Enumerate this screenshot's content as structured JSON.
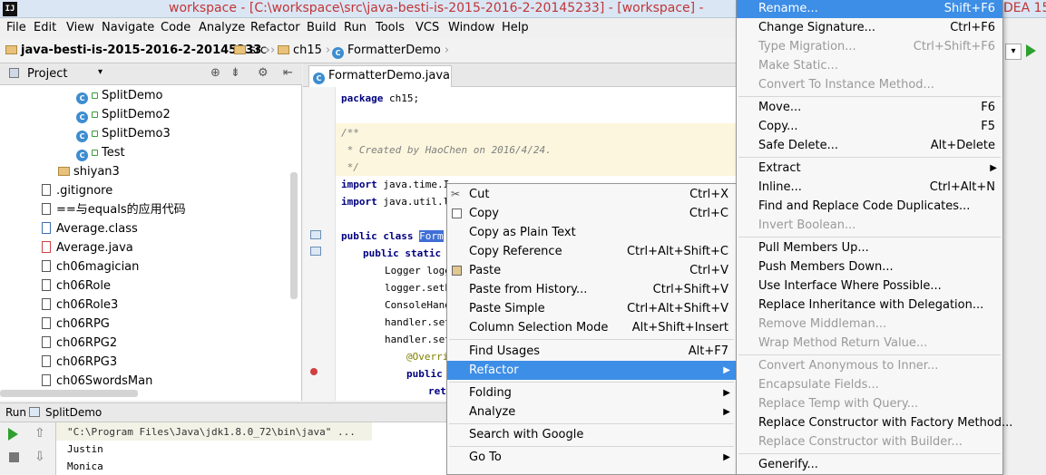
{
  "window": {
    "title": "workspace - [C:\\workspace\\src\\java-besti-is-2015-2016-2-20145233] - [workspace] -",
    "title_right": "DEA 15",
    "logo": "IJ"
  },
  "menubar": {
    "items": [
      "File",
      "Edit",
      "View",
      "Navigate",
      "Code",
      "Analyze",
      "Refactor",
      "Build",
      "Run",
      "Tools",
      "VCS",
      "Window",
      "Help"
    ]
  },
  "breadcrumb": {
    "items": [
      "java-besti-is-2015-2016-2-20145233",
      "src",
      "ch15",
      "FormatterDemo"
    ]
  },
  "project_panel": {
    "title": "Project",
    "tree": [
      {
        "label": "SplitDemo",
        "kind": "class"
      },
      {
        "label": "SplitDemo2",
        "kind": "class"
      },
      {
        "label": "SplitDemo3",
        "kind": "class"
      },
      {
        "label": "Test",
        "kind": "class"
      },
      {
        "label": "shiyan3",
        "kind": "folder"
      },
      {
        "label": ".gitignore",
        "kind": "file"
      },
      {
        "label": "==与equals的应用代码",
        "kind": "file"
      },
      {
        "label": "Average.class",
        "kind": "file"
      },
      {
        "label": "Average.java",
        "kind": "file"
      },
      {
        "label": "ch06magician",
        "kind": "file"
      },
      {
        "label": "ch06Role",
        "kind": "file"
      },
      {
        "label": "ch06Role3",
        "kind": "file"
      },
      {
        "label": "ch06RPG",
        "kind": "file"
      },
      {
        "label": "ch06RPG2",
        "kind": "file"
      },
      {
        "label": "ch06RPG3",
        "kind": "file"
      },
      {
        "label": "ch06SwordsMan",
        "kind": "file"
      }
    ]
  },
  "editor": {
    "tab_label": "FormatterDemo.java",
    "lines": {
      "l1_kw": "package",
      "l1_rest": " ch15;",
      "c1": "/**",
      "c2": " * Created by HaoChen on 2016/4/24.",
      "c3": " */",
      "i1_kw": "import",
      "i1_rest": " java.time.I",
      "i2_kw": "import",
      "i2_rest": " java.util.l",
      "cls_kw": "public class",
      "cls_sel": "Form",
      "m_kw": "public static",
      "s1": "Logger logg",
      "s2": "logger.setL",
      "s3": "ConsoleHand",
      "s4": "handler.set",
      "s5": "handler.set",
      "s6": "@Overri",
      "s7_kw": "public",
      "s8": "ret"
    }
  },
  "run_panel": {
    "label": "Run",
    "config": "SplitDemo",
    "console": [
      "\"C:\\Program Files\\Java\\jdk1.8.0_72\\bin\\java\" ...",
      "Justin",
      "Monica"
    ]
  },
  "context_menu": {
    "items": [
      {
        "label": "Cut",
        "shortcut": "Ctrl+X"
      },
      {
        "label": "Copy",
        "shortcut": "Ctrl+C"
      },
      {
        "label": "Copy as Plain Text",
        "shortcut": ""
      },
      {
        "label": "Copy Reference",
        "shortcut": "Ctrl+Alt+Shift+C"
      },
      {
        "label": "Paste",
        "shortcut": "Ctrl+V"
      },
      {
        "label": "Paste from History...",
        "shortcut": "Ctrl+Shift+V"
      },
      {
        "label": "Paste Simple",
        "shortcut": "Ctrl+Alt+Shift+V"
      },
      {
        "label": "Column Selection Mode",
        "shortcut": "Alt+Shift+Insert"
      },
      {
        "label": "Find Usages",
        "shortcut": "Alt+F7"
      },
      {
        "label": "Refactor",
        "shortcut": ""
      },
      {
        "label": "Folding",
        "shortcut": ""
      },
      {
        "label": "Analyze",
        "shortcut": ""
      },
      {
        "label": "Search with Google",
        "shortcut": ""
      },
      {
        "label": "Go To",
        "shortcut": ""
      }
    ]
  },
  "refactor_menu": {
    "items": [
      {
        "label": "Rename...",
        "shortcut": "Shift+F6"
      },
      {
        "label": "Change Signature...",
        "shortcut": "Ctrl+F6"
      },
      {
        "label": "Type Migration...",
        "shortcut": "Ctrl+Shift+F6"
      },
      {
        "label": "Make Static...",
        "shortcut": ""
      },
      {
        "label": "Convert To Instance Method...",
        "shortcut": ""
      },
      {
        "label": "Move...",
        "shortcut": "F6"
      },
      {
        "label": "Copy...",
        "shortcut": "F5"
      },
      {
        "label": "Safe Delete...",
        "shortcut": "Alt+Delete"
      },
      {
        "label": "Extract",
        "shortcut": ""
      },
      {
        "label": "Inline...",
        "shortcut": "Ctrl+Alt+N"
      },
      {
        "label": "Find and Replace Code Duplicates...",
        "shortcut": ""
      },
      {
        "label": "Invert Boolean...",
        "shortcut": ""
      },
      {
        "label": "Pull Members Up...",
        "shortcut": ""
      },
      {
        "label": "Push Members Down...",
        "shortcut": ""
      },
      {
        "label": "Use Interface Where Possible...",
        "shortcut": ""
      },
      {
        "label": "Replace Inheritance with Delegation...",
        "shortcut": ""
      },
      {
        "label": "Remove Middleman...",
        "shortcut": ""
      },
      {
        "label": "Wrap Method Return Value...",
        "shortcut": ""
      },
      {
        "label": "Convert Anonymous to Inner...",
        "shortcut": ""
      },
      {
        "label": "Encapsulate Fields...",
        "shortcut": ""
      },
      {
        "label": "Replace Temp with Query...",
        "shortcut": ""
      },
      {
        "label": "Replace Constructor with Factory Method...",
        "shortcut": ""
      },
      {
        "label": "Replace Constructor with Builder...",
        "shortcut": ""
      },
      {
        "label": "Generify...",
        "shortcut": ""
      }
    ]
  },
  "colors": {
    "title_text": "#c03535",
    "menu_highlight": "#3d8ee6",
    "selection": "#3f6fd6",
    "keyword": "#000080",
    "comment": "#808080"
  }
}
